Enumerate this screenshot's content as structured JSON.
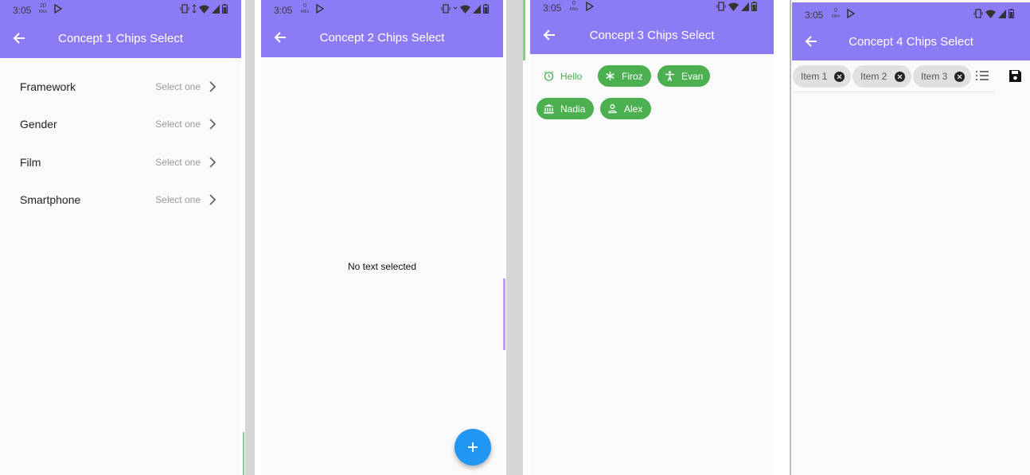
{
  "screens": [
    {
      "status": {
        "time": "3:05",
        "netspeed": "20",
        "netunit": "KB/s"
      },
      "title": "Concept 1 Chips Select",
      "rows": [
        {
          "label": "Framework",
          "value": "Select one"
        },
        {
          "label": "Gender",
          "value": "Select one"
        },
        {
          "label": "Film",
          "value": "Select one"
        },
        {
          "label": "Smartphone",
          "value": "Select one"
        }
      ]
    },
    {
      "status": {
        "time": "3:05",
        "netspeed": "0",
        "netunit": "KB/s"
      },
      "title": "Concept 2 Chips Select",
      "empty_text": "No text selected",
      "fab_icon": "plus-icon"
    },
    {
      "status": {
        "time": "3:05",
        "netspeed": "0",
        "netunit": "KB/s"
      },
      "title": "Concept 3 Chips Select",
      "chips": [
        {
          "label": "Hello",
          "icon": "alarm-icon",
          "selected": false
        },
        {
          "label": "Firoz",
          "icon": "snowflake-icon",
          "selected": true
        },
        {
          "label": "Evan",
          "icon": "accessibility-icon",
          "selected": true
        },
        {
          "label": "Nadia",
          "icon": "bank-icon",
          "selected": true
        },
        {
          "label": "Alex",
          "icon": "person-icon",
          "selected": true
        }
      ]
    },
    {
      "status": {
        "time": "3:05",
        "netspeed": "0",
        "netunit": "KB/s"
      },
      "title": "Concept 4 Chips Select",
      "items": [
        {
          "label": "Item 1"
        },
        {
          "label": "Item 2"
        },
        {
          "label": "Item 3"
        }
      ],
      "actions": [
        "list-icon",
        "save-icon"
      ]
    }
  ],
  "colors": {
    "appbar": "#8b7cf6",
    "chip_green": "#4caf50",
    "fab": "#2196f3"
  }
}
